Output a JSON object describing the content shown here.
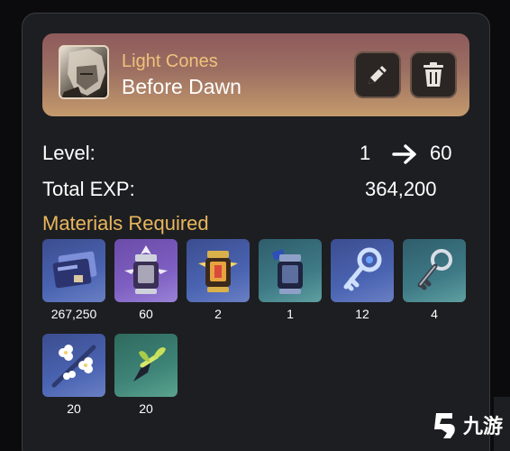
{
  "light_cone": {
    "label": "Light Cones",
    "name": "Before Dawn"
  },
  "stats": {
    "level_label": "Level:",
    "level_from": "1",
    "level_to": "60",
    "exp_label": "Total EXP:",
    "exp_value": "364,200"
  },
  "materials": {
    "title": "Materials Required",
    "items": [
      {
        "icon": "exp-material-card-icon",
        "count": "267,250"
      },
      {
        "icon": "lantern-purple-icon",
        "count": "60"
      },
      {
        "icon": "lantern-gold-icon",
        "count": "2"
      },
      {
        "icon": "lantern-blue-icon",
        "count": "1"
      },
      {
        "icon": "key-blue-icon",
        "count": "12"
      },
      {
        "icon": "key-silver-icon",
        "count": "4"
      },
      {
        "icon": "flower-branch-icon",
        "count": "20"
      },
      {
        "icon": "sprout-icon",
        "count": "20"
      }
    ]
  },
  "watermark": {
    "text": "九游"
  },
  "colors": {
    "accent_gold": "#e8b65d",
    "panel_bg": "#1d1e21",
    "header_gradient_top": "#8e5a5c",
    "header_gradient_bottom": "#c49a6c"
  }
}
